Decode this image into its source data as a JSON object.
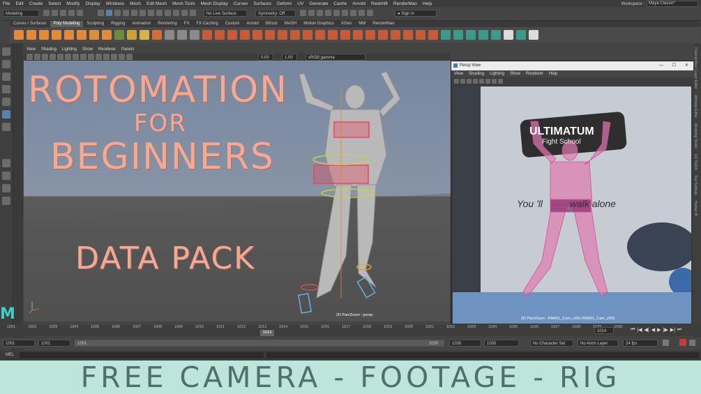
{
  "menubar": {
    "items": [
      "File",
      "Edit",
      "Create",
      "Select",
      "Modify",
      "Display",
      "Windows",
      "Mesh",
      "Edit Mesh",
      "Mesh Tools",
      "Mesh Display",
      "Curves",
      "Surfaces",
      "Deform",
      "UV",
      "Generate",
      "Cache",
      "Arnold",
      "Redshift",
      "RenderMan",
      "Help"
    ],
    "workspace_label": "Workspace :",
    "workspace_value": "Maya Classic*"
  },
  "statusline": {
    "mode": "Modeling",
    "live_surface": "No Live Surface",
    "symmetry": "Symmetry: Off",
    "sign_in": "Sign In"
  },
  "shelf": {
    "tabs": [
      "Curves / Surfaces",
      "Poly Modeling",
      "Sculpting",
      "Rigging",
      "Animation",
      "Rendering",
      "FX",
      "FX Caching",
      "Custom",
      "Arnold",
      "Bifrost",
      "MASH",
      "Motion Graphics",
      "XGen",
      "MM",
      "RenderMan"
    ],
    "active_tab": "Poly Modeling"
  },
  "viewport": {
    "menu": [
      "View",
      "Shading",
      "Lighting",
      "Show",
      "Renderer",
      "Panels"
    ],
    "exposure": "0.00",
    "gamma": "1.00",
    "colorspace": "sRGB gamma",
    "label": "2D Pan/Zoom : persp"
  },
  "overlay": {
    "line1": "ROTOMATION",
    "line2": "FOR",
    "line3": "BEGINNERS",
    "line4": "DATA PACK"
  },
  "persp_window": {
    "title": "Persp View",
    "menu": [
      "View",
      "Shading",
      "Lighting",
      "Show",
      "Renderer",
      "Help"
    ],
    "wall_text": "You 'll          walk alone",
    "sign_text": "ULTIMATUM",
    "sign_sub": "Fight School",
    "label": "2D Pan/Zoom : RM001_Cam_v001:RM001_Cam_v001"
  },
  "timeline": {
    "ticks": [
      "1001",
      "1002",
      "1003",
      "1004",
      "1005",
      "1006",
      "1007",
      "1008",
      "1009",
      "1010",
      "1011",
      "1012",
      "1013",
      "1014",
      "1015",
      "1016",
      "1017",
      "1018",
      "1019",
      "1020",
      "1021",
      "1022",
      "1023",
      "1024",
      "1025",
      "1026",
      "1027",
      "1028",
      "1029",
      "1030"
    ],
    "current_frame": "1014",
    "current_field": "1014"
  },
  "range": {
    "start": "1001",
    "anim_start": "1001",
    "slider_start": "1001",
    "slider_end": "1030",
    "anim_end": "1030",
    "end": "1030",
    "character_set": "No Character Set",
    "anim_layer": "No Anim Layer",
    "fps": "24 fps"
  },
  "command_line": {
    "label": "MEL"
  },
  "right_panel_tabs": [
    "Channel Box / Layer Editor",
    "Attribute Editor",
    "Modeling Toolkit",
    "UV Toolkit",
    "Tool Settings",
    "Human IK"
  ],
  "banner": {
    "text": "FREE CAMERA - FOOTAGE - RIG"
  },
  "colors": {
    "title_salmon": "#f4a994",
    "banner_bg": "#bde5dc",
    "banner_text": "#4f6f6d",
    "rig_red": "#e8465a"
  }
}
